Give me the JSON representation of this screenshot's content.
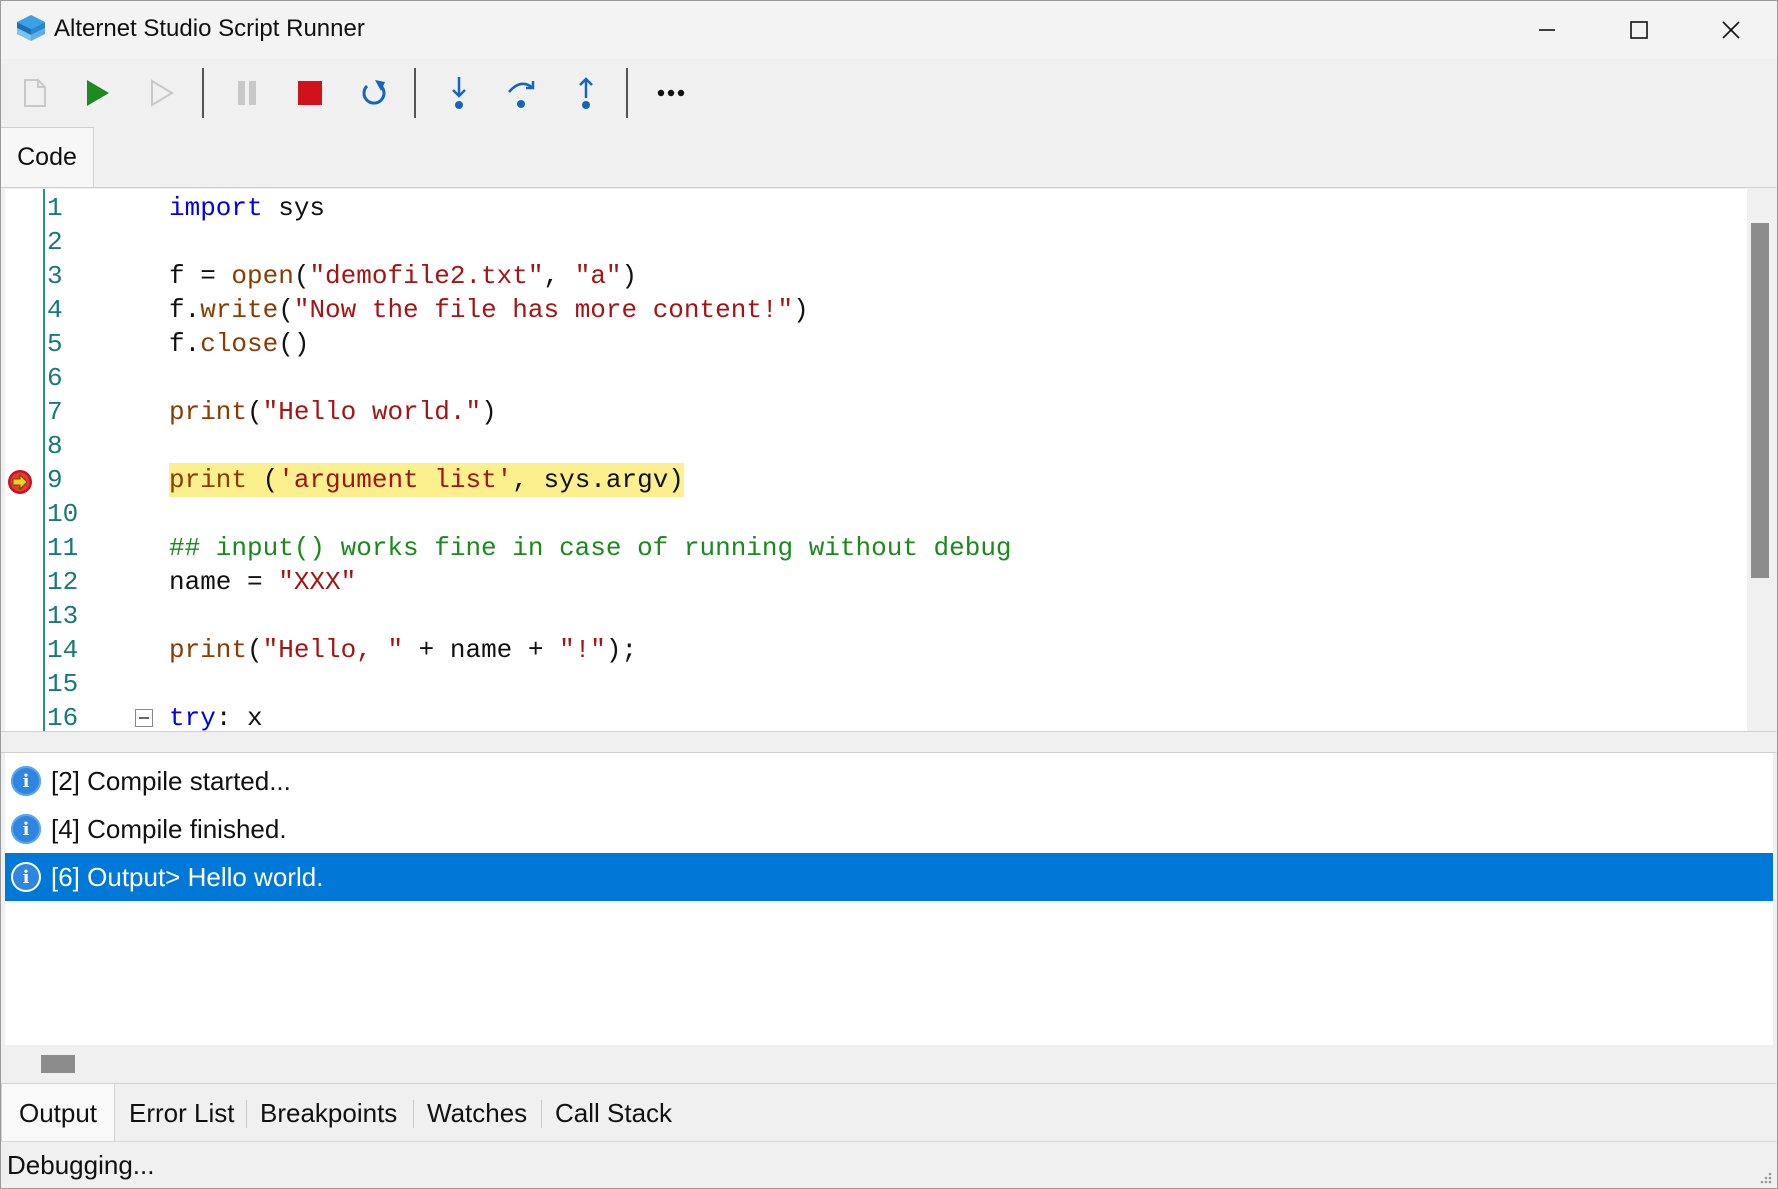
{
  "window": {
    "title": "Alternet Studio Script Runner"
  },
  "toolbar": {
    "buttons": [
      {
        "name": "new-file-icon",
        "enabled": false
      },
      {
        "name": "run-icon",
        "enabled": true
      },
      {
        "name": "run-without-debug-icon",
        "enabled": false
      },
      {
        "name": "pause-icon",
        "enabled": false
      },
      {
        "name": "stop-icon",
        "enabled": true
      },
      {
        "name": "restart-icon",
        "enabled": true
      },
      {
        "name": "step-into-icon",
        "enabled": true
      },
      {
        "name": "step-over-icon",
        "enabled": true
      },
      {
        "name": "step-out-icon",
        "enabled": true
      },
      {
        "name": "more-icon",
        "enabled": true
      }
    ]
  },
  "editor": {
    "tab_label": "Code",
    "current_line": 9,
    "lines": [
      {
        "n": "1"
      },
      {
        "n": "2"
      },
      {
        "n": "3"
      },
      {
        "n": "4"
      },
      {
        "n": "5"
      },
      {
        "n": "6"
      },
      {
        "n": "7"
      },
      {
        "n": "8"
      },
      {
        "n": "9"
      },
      {
        "n": "10"
      },
      {
        "n": "11"
      },
      {
        "n": "12"
      },
      {
        "n": "13"
      },
      {
        "n": "14"
      },
      {
        "n": "15"
      },
      {
        "n": "16"
      }
    ],
    "code": {
      "l1_kw": "import",
      "l1_rest": " sys",
      "l3_a": "f = ",
      "l3_fn": "open",
      "l3_b": "(",
      "l3_s1": "\"demofile2.txt\"",
      "l3_c": ", ",
      "l3_s2": "\"a\"",
      "l3_d": ")",
      "l4_a": "f.",
      "l4_fn": "write",
      "l4_b": "(",
      "l4_s": "\"Now the file has more content!\"",
      "l4_c": ")",
      "l5_a": "f.",
      "l5_fn": "close",
      "l5_b": "()",
      "l7_fn": "print",
      "l7_b": "(",
      "l7_s": "\"Hello world.\"",
      "l7_c": ")",
      "l9_fn": "print",
      "l9_b": " (",
      "l9_s": "'argument list'",
      "l9_c": ", sys.argv)",
      "l11_cm": "## input() works fine in case of running without debug",
      "l12_a": "name = ",
      "l12_s": "\"XXX\"",
      "l14_fn": "print",
      "l14_b": "(",
      "l14_s1": "\"Hello, \"",
      "l14_c": " + name + ",
      "l14_s2": "\"!\"",
      "l14_d": ");",
      "l16_kw": "try",
      "l16_rest": ": x"
    }
  },
  "output": {
    "messages": [
      {
        "text": "[2] Compile started...",
        "selected": false
      },
      {
        "text": "[4] Compile finished.",
        "selected": false
      },
      {
        "text": "[6] Output> Hello world.",
        "selected": true
      }
    ]
  },
  "bottom_tabs": {
    "output": "Output",
    "error_list": "Error List",
    "breakpoints": "Breakpoints",
    "watches": "Watches",
    "call_stack": "Call Stack",
    "active": "Output"
  },
  "status": {
    "text": "Debugging..."
  },
  "colors": {
    "selection": "#0078d7",
    "current_line_highlight": "#fbef8e",
    "keyword": "#0000e6",
    "string": "#a31515",
    "comment": "#1a8a1a",
    "line_number": "#177a7a"
  }
}
